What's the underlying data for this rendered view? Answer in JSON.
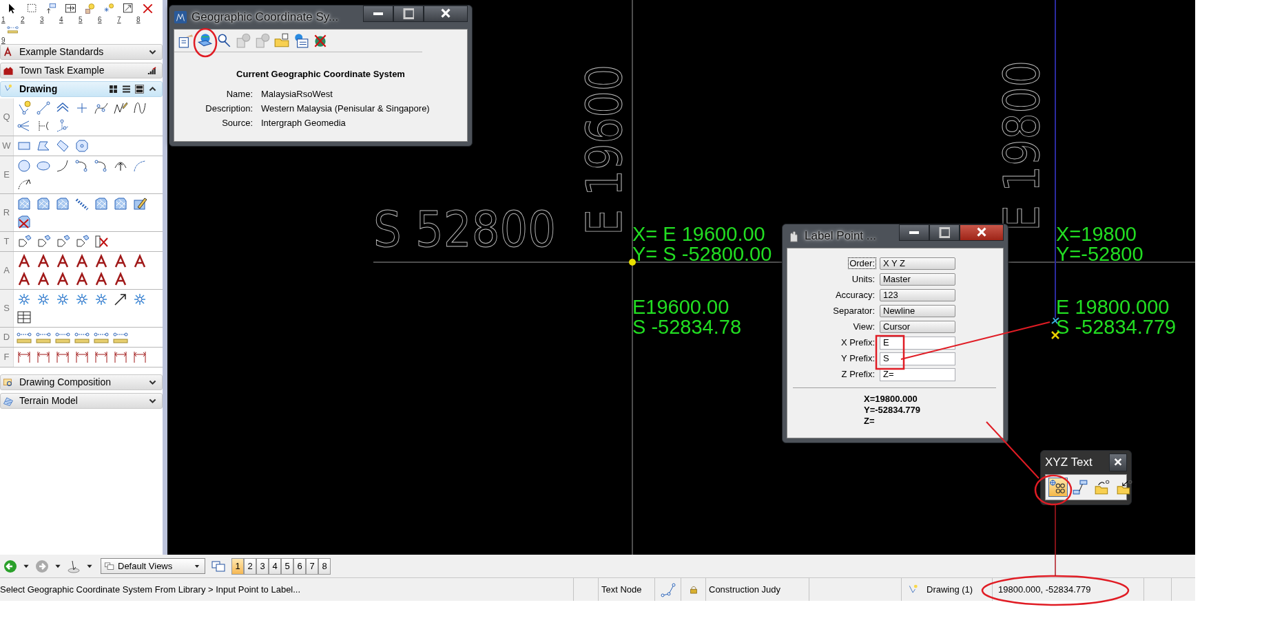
{
  "task_strip": {
    "keys": [
      "1",
      "2",
      "3",
      "4",
      "5",
      "6",
      "7",
      "8",
      "9"
    ]
  },
  "panels": [
    {
      "title": "Example Standards",
      "kind": "section",
      "expanded": false
    },
    {
      "title": "Town Task Example",
      "kind": "task",
      "expanded": false
    },
    {
      "title": "Drawing",
      "kind": "section",
      "expanded": true,
      "groups": [
        {
          "key": "Q"
        },
        {
          "key": "W"
        },
        {
          "key": "E"
        },
        {
          "key": "R"
        },
        {
          "key": "T"
        },
        {
          "key": "A"
        },
        {
          "key": "S"
        },
        {
          "key": "D"
        },
        {
          "key": "F"
        }
      ]
    },
    {
      "title": "Drawing Composition",
      "kind": "section",
      "expanded": false
    },
    {
      "title": "Terrain Model",
      "kind": "section",
      "expanded": false
    }
  ],
  "canvas": {
    "grid_labels": [
      {
        "text": "S  52800"
      },
      {
        "text": "E 19600"
      },
      {
        "text": "E 19800"
      }
    ],
    "point_labels": [
      {
        "lines": [
          "X= E 19600.00",
          "Y= S -52800.00"
        ]
      },
      {
        "lines": [
          "E19600.00",
          "S -52834.78"
        ]
      },
      {
        "lines": [
          "X=19800",
          "Y=-52800"
        ]
      },
      {
        "lines": [
          "E  19800.000",
          "S -52834.779"
        ]
      }
    ]
  },
  "gcs_dialog": {
    "title": "Geographic Coordinate Sy...",
    "heading": "Current Geographic Coordinate System",
    "fields": [
      {
        "label": "Name:",
        "value": "MalaysiaRsoWest"
      },
      {
        "label": "Description:",
        "value": "Western Malaysia (Penisular & Singapore)"
      },
      {
        "label": "Source:",
        "value": "Intergraph Geomedia"
      }
    ]
  },
  "label_point_dialog": {
    "title": "Label Point ...",
    "fields": [
      {
        "label": "Order:",
        "value": "X Y Z",
        "kind": "dropdown",
        "focused": true
      },
      {
        "label": "Units:",
        "value": "Master",
        "kind": "dropdown",
        "focused": false
      },
      {
        "label": "Accuracy:",
        "value": "123",
        "kind": "dropdown",
        "focused": false
      },
      {
        "label": "Separator:",
        "value": "Newline",
        "kind": "dropdown",
        "focused": false
      },
      {
        "label": "View:",
        "value": "Cursor",
        "kind": "dropdown",
        "focused": false
      },
      {
        "label": "X Prefix:",
        "value": "E",
        "kind": "text",
        "focused": false
      },
      {
        "label": "Y Prefix:",
        "value": "S",
        "kind": "text",
        "focused": false
      },
      {
        "label": "Z Prefix:",
        "value": "Z=",
        "kind": "text",
        "focused": false
      }
    ],
    "readout": [
      "X=19800.000",
      "Y=-52834.779",
      "Z="
    ]
  },
  "xyz_text_dialog": {
    "title": "XYZ Text",
    "tools": [
      {
        "selected": true
      },
      {
        "selected": false
      },
      {
        "selected": false
      },
      {
        "selected": false
      }
    ]
  },
  "view_toolbar": {
    "view_group": "Default Views",
    "views": [
      {
        "label": "1",
        "selected": true
      },
      {
        "label": "2",
        "selected": false
      },
      {
        "label": "3",
        "selected": false
      },
      {
        "label": "4",
        "selected": false
      },
      {
        "label": "5",
        "selected": false
      },
      {
        "label": "6",
        "selected": false
      },
      {
        "label": "7",
        "selected": false
      },
      {
        "label": "8",
        "selected": false
      }
    ]
  },
  "status_bar": {
    "message": "Select Geographic Coordinate System From Library > Input Point to Label...",
    "text_style": "Text Node",
    "level": "Construction Judy",
    "model": "Drawing (1)",
    "coordinates": "19800.000, -52834.779"
  }
}
